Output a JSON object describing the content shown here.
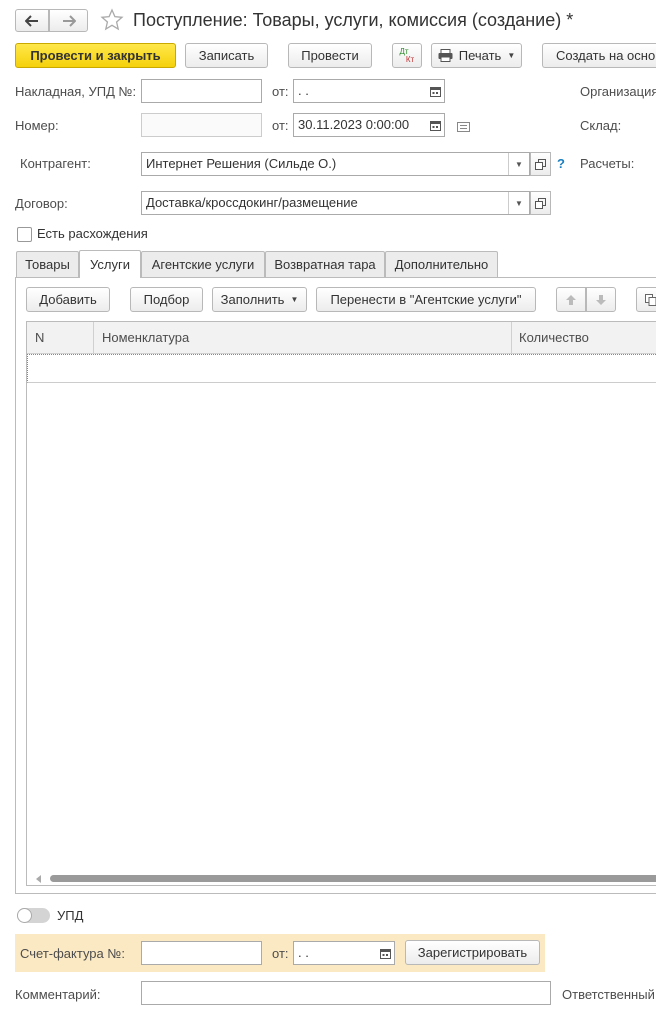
{
  "window": {
    "title": "Поступление: Товары, услуги, комиссия (создание) *"
  },
  "toolbar": {
    "post_close": "Провести и закрыть",
    "save": "Записать",
    "post": "Провести",
    "dtkt_top": "Дт",
    "dtkt_bottom": "Кт",
    "print": "Печать",
    "create_based": "Создать на осно"
  },
  "header": {
    "invoice_label": "Накладная, УПД №:",
    "invoice_value": "",
    "from1_label": "от:",
    "from1_value": " .  .",
    "number_label": "Номер:",
    "number_value": "",
    "from2_label": "от:",
    "from2_value": "30.11.2023  0:00:00",
    "org_label": "Организация",
    "warehouse_label": "Склад:",
    "counterparty_label": "Контрагент:",
    "counterparty_value": "Интернет Решения (Сильде О.)",
    "help": "?",
    "settlements_label": "Расчеты:",
    "contract_label": "Договор:",
    "contract_value": "Доставка/кроссдокинг/размещение",
    "discrepancy_label": "Есть расхождения"
  },
  "tabs": [
    {
      "label": "Товары"
    },
    {
      "label": "Услуги"
    },
    {
      "label": "Агентские услуги"
    },
    {
      "label": "Возвратная тара"
    },
    {
      "label": "Дополнительно"
    }
  ],
  "table_toolbar": {
    "add": "Добавить",
    "select": "Подбор",
    "fill": "Заполнить",
    "move": "Перенести в \"Агентские услуги\""
  },
  "table": {
    "columns": [
      "N",
      "Номенклатура",
      "Количество"
    ]
  },
  "footer": {
    "upd_label": "УПД",
    "sf_label": "Счет-фактура №:",
    "sf_value": "",
    "sf_from_label": "от:",
    "sf_from_value": " .  .",
    "register": "Зарегистрировать",
    "comment_label": "Комментарий:",
    "comment_value": "",
    "responsible_label": "Ответственный:"
  },
  "colors": {
    "primary": "#f5d10b",
    "invoice_highlight": "#fbe9c3"
  }
}
